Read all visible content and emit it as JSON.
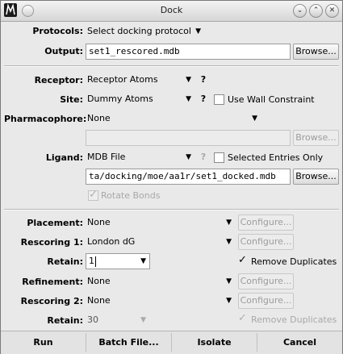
{
  "window": {
    "title": "Dock",
    "buttons": {
      "minimize": "⌄",
      "maximize": "⌃",
      "close": "✕"
    }
  },
  "protocols": {
    "label": "Protocols:",
    "value": "Select docking protocol",
    "arrow": "▼"
  },
  "output": {
    "label": "Output:",
    "value": "set1_rescored.mdb",
    "browse": "Browse..."
  },
  "receptor": {
    "label": "Receptor:",
    "value": "Receptor Atoms",
    "help": "?"
  },
  "site": {
    "label": "Site:",
    "value": "Dummy Atoms",
    "help": "?",
    "wall_label": "Use Wall Constraint",
    "wall_checked": false
  },
  "pharmacophore": {
    "label": "Pharmacophore:",
    "value": "None",
    "file": "",
    "browse": "Browse..."
  },
  "ligand": {
    "label": "Ligand:",
    "value": "MDB File",
    "help": "?",
    "selected_label": "Selected Entries Only",
    "selected_checked": false,
    "path": "ta/docking/moe/aa1r/set1_docked.mdb",
    "browse": "Browse...",
    "rotate_label": "Rotate Bonds",
    "rotate_checked": true
  },
  "placement": {
    "label": "Placement:",
    "value": "None",
    "configure": "Configure..."
  },
  "rescoring1": {
    "label": "Rescoring 1:",
    "value": "London dG",
    "configure": "Configure..."
  },
  "retain1": {
    "label": "Retain:",
    "value": "1",
    "remove_label": "Remove Duplicates",
    "remove_checked": true
  },
  "refinement": {
    "label": "Refinement:",
    "value": "None",
    "configure": "Configure..."
  },
  "rescoring2": {
    "label": "Rescoring 2:",
    "value": "None",
    "configure": "Configure..."
  },
  "retain2": {
    "label": "Retain:",
    "value": "30",
    "remove_label": "Remove Duplicates",
    "remove_checked": true
  },
  "bottom": {
    "run": "Run",
    "batch": "Batch File...",
    "isolate": "Isolate",
    "cancel": "Cancel"
  },
  "arrow": "▼"
}
